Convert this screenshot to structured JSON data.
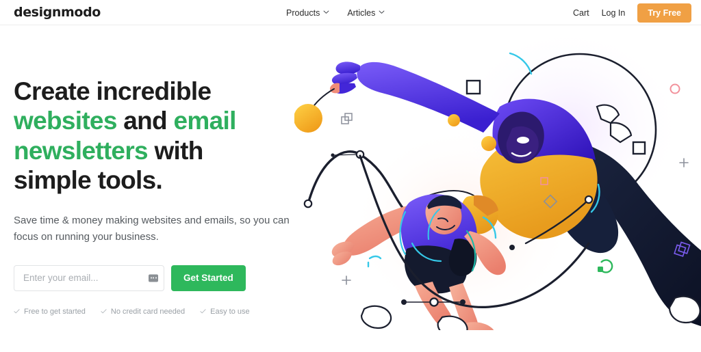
{
  "brand": {
    "logo_text": "designmodo",
    "accent_green": "#2eb85c",
    "accent_green_text": "#2faf5e",
    "accent_orange": "#f0a044",
    "text_dark": "#1d1d1d",
    "text_muted": "#555a5f",
    "feature_muted": "#9aa0a6"
  },
  "header": {
    "nav_main": [
      {
        "label": "Products",
        "icon": "chevron-down-icon"
      },
      {
        "label": "Articles",
        "icon": "chevron-down-icon"
      }
    ],
    "nav_right": {
      "cart_label": "Cart",
      "login_label": "Log In",
      "try_free_label": "Try Free"
    }
  },
  "hero": {
    "headline": {
      "line1_plain": "Create incredible",
      "line2_green": "websites",
      "line2_plain": " and ",
      "line2_green2": "email",
      "line3_green": "newsletters",
      "line3_plain": " with",
      "line4_plain": "simple tools."
    },
    "subhead": "Save time & money making websites and emails, so you can focus on running your business.",
    "form": {
      "email_placeholder": "Enter your email...",
      "email_value": "",
      "autofill_icon": "keyboard-autofill-icon",
      "submit_label": "Get Started"
    },
    "features": [
      {
        "icon": "check-icon",
        "label": "Free to get started"
      },
      {
        "icon": "check-icon",
        "label": "No credit card needed"
      },
      {
        "icon": "check-icon",
        "label": "Easy to use"
      }
    ],
    "illustration": {
      "name": "designers-on-bezier-curves-illustration",
      "alt": "Two illustrated figures posing on vector bezier curves with anchor points",
      "colors": {
        "purple": "#5b3fe8",
        "indigo": "#3a1fd0",
        "yellow": "#f4b223",
        "orange": "#e08a27",
        "navy": "#121a33",
        "skin": "#f08c78",
        "skin_light": "#f5a792",
        "cyan": "#35c8e8",
        "pink_outline": "#f2919b",
        "violet_outline": "#7b5cf0",
        "stroke": "#1b1f2e"
      },
      "decor": [
        {
          "name": "circle-outline-decor",
          "color": "#f2919b"
        },
        {
          "name": "plus-decor",
          "color": "#8b8f9a"
        },
        {
          "name": "stacked-squares-decor",
          "color": "#7b5cf0"
        },
        {
          "name": "diamond-outline-decor",
          "color": "#8b8f9a"
        },
        {
          "name": "small-square-decor",
          "color": "#f2919b"
        },
        {
          "name": "headphones-icon-decor",
          "color": "#2eb85c"
        }
      ]
    }
  }
}
